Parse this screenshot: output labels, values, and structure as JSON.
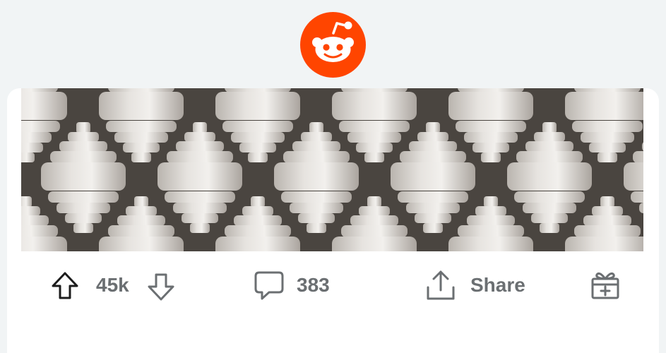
{
  "logo": {
    "icon": "reddit-snoo-icon",
    "color": "#ff4500"
  },
  "post": {
    "image_alt_icon": "ceramic-tiles-image",
    "upvotes": "45k",
    "comments": "383",
    "share_label": "Share"
  },
  "icons": {
    "upvote": "arrow-up-icon",
    "downvote": "arrow-down-icon",
    "comment": "speech-bubble-icon",
    "share": "share-upload-icon",
    "award": "gift-award-icon"
  }
}
